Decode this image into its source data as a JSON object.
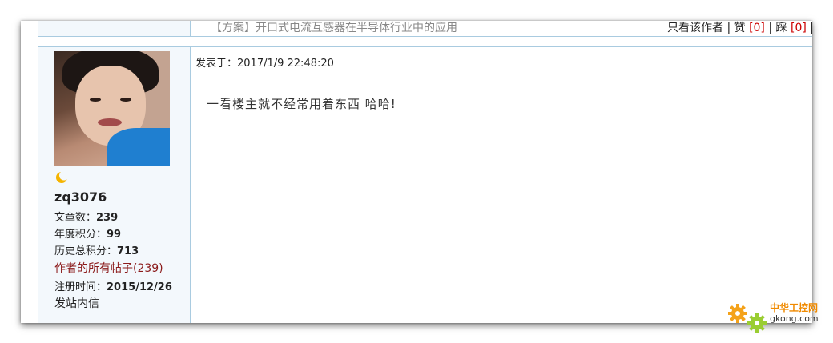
{
  "previous_post": {
    "title": "【方案】开口式电流互感器在半导体行业中的应用",
    "only_author_label": "只看该作者",
    "separator": "|",
    "like_label": "赞",
    "like_count": "[0]",
    "dislike_label": "踩",
    "dislike_count": "[0]",
    "more_label": "|"
  },
  "post": {
    "posted_at": "发表于：2017/1/9 22:48:20",
    "body": "一看楼主就不经常用着东西 哈哈!"
  },
  "author": {
    "username": "zq3076",
    "level_icon": "moon-icon",
    "articles_label": "文章数：",
    "articles_value": "239",
    "year_points_label": "年度积分：",
    "year_points_value": "99",
    "total_points_label": "历史总积分：",
    "total_points_value": "713",
    "all_posts_link": "作者的所有帖子(239)",
    "registered_label": "注册时间：",
    "registered_value": "2015/12/26",
    "send_pm_link": "发站内信"
  },
  "watermark": {
    "line1": "中华工控网",
    "line2": "gkong.com"
  },
  "colors": {
    "border": "#a9cbe0",
    "sidebar_bg": "#f3f8fc",
    "link_red": "#8b1a1a",
    "count_red": "#cc0000",
    "watermark_orange": "#f08a00"
  }
}
